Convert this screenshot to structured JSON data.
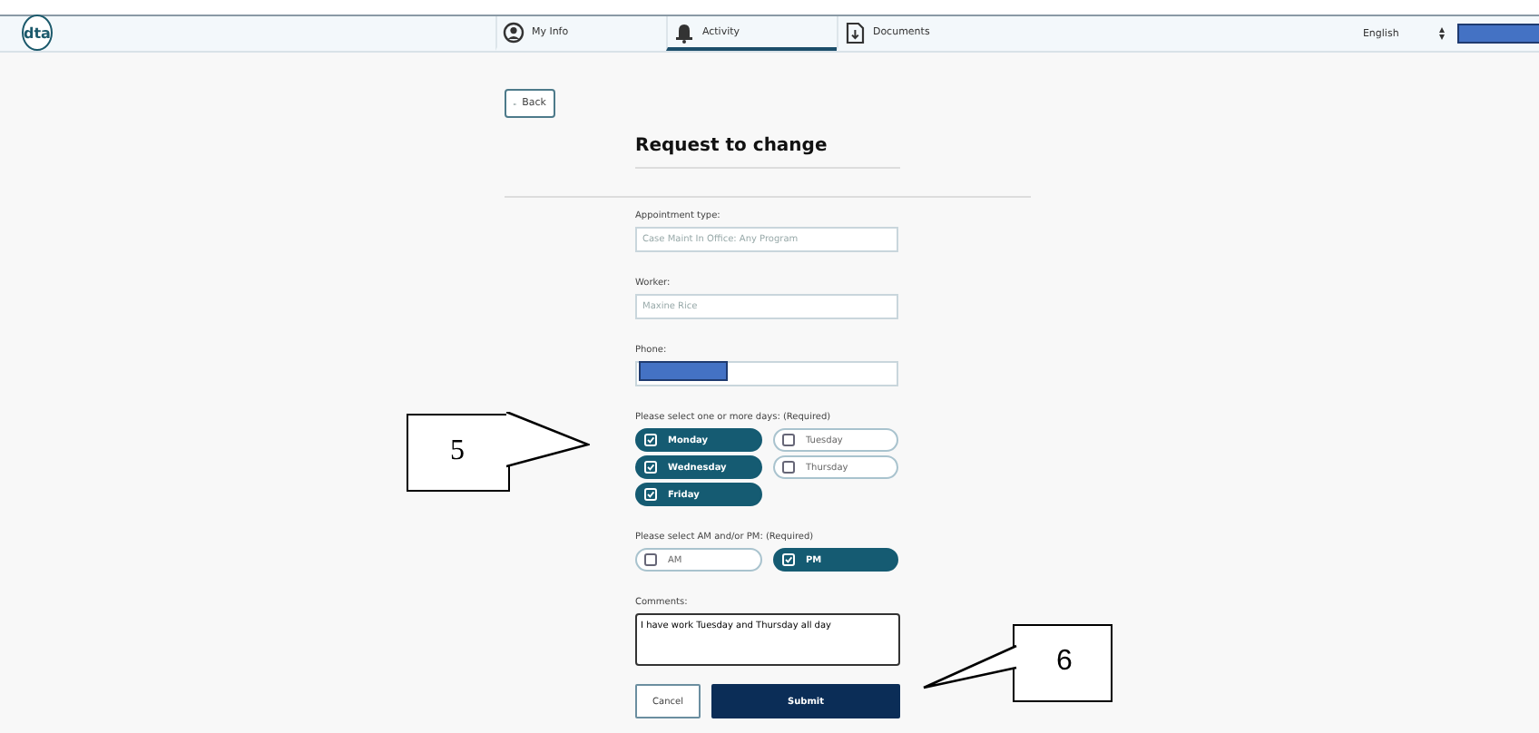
{
  "nav": {
    "logo": "dta",
    "tabs": [
      {
        "label": "My Info",
        "selected": false
      },
      {
        "label": "Activity",
        "selected": true
      },
      {
        "label": "Documents",
        "selected": false
      }
    ],
    "language": "English",
    "account_redacted": true
  },
  "back_button": "Back",
  "title": "Request to change",
  "form": {
    "fields": [
      {
        "label": "Appointment type:",
        "placeholder": "Case Maint In Office: Any Program"
      },
      {
        "label": "Worker:",
        "placeholder": "Maxine Rice"
      },
      {
        "label": "Phone:",
        "redacted": true
      }
    ],
    "days": {
      "label": "Please select one or more days: (Required)",
      "options": [
        {
          "label": "Monday",
          "selected": true
        },
        {
          "label": "Tuesday",
          "selected": false
        },
        {
          "label": "Wednesday",
          "selected": true
        },
        {
          "label": "Thursday",
          "selected": false
        },
        {
          "label": "Friday",
          "selected": true
        }
      ]
    },
    "times": {
      "label": "Please select AM and/or PM: (Required)",
      "options": [
        {
          "label": "AM",
          "selected": false
        },
        {
          "label": "PM",
          "selected": true
        }
      ]
    },
    "comments": {
      "label": "Comments:",
      "value": "I have work Tuesday and Thursday all day"
    },
    "buttons": [
      {
        "label": "Cancel",
        "kind": "secondary"
      },
      {
        "label": "Submit",
        "kind": "primary"
      }
    ]
  },
  "callouts": [
    {
      "label": "5"
    },
    {
      "label": "6"
    }
  ]
}
